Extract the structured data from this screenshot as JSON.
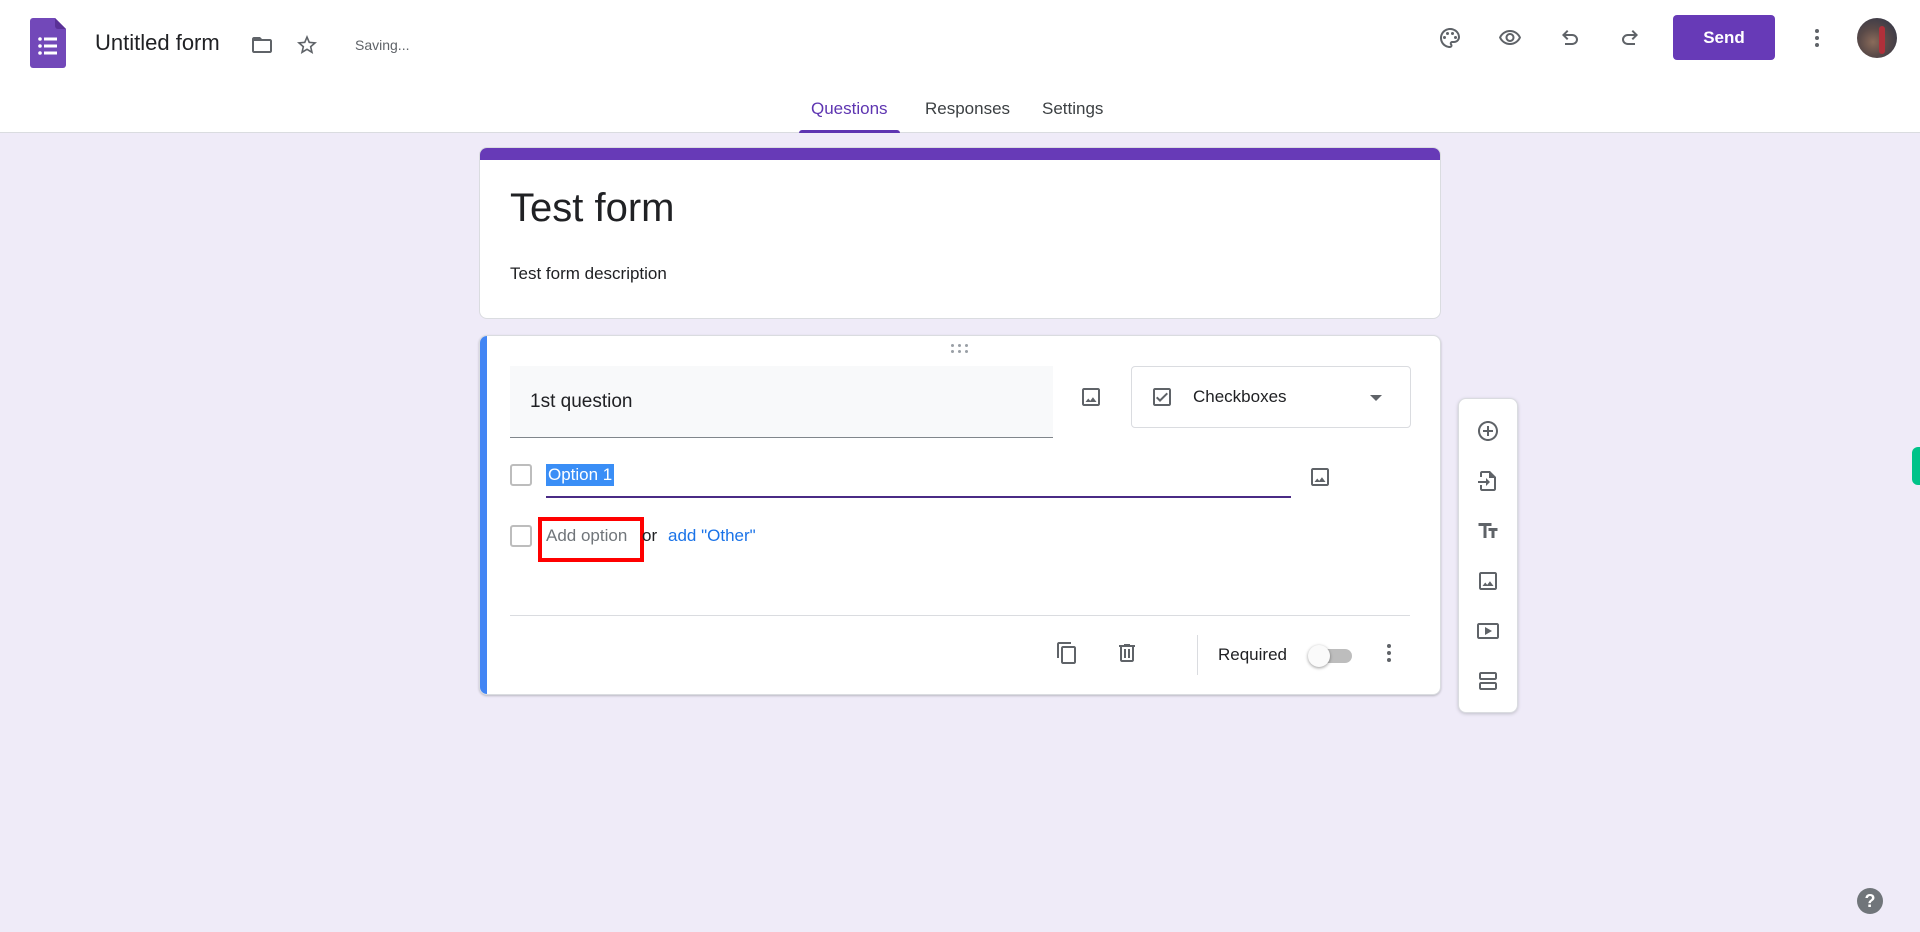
{
  "header": {
    "doc_title": "Untitled form",
    "status": "Saving...",
    "send_label": "Send",
    "icons": [
      "forms-logo-icon",
      "folder-icon",
      "star-icon",
      "palette-icon",
      "preview-eye-icon",
      "undo-icon",
      "redo-icon",
      "more-vert-icon",
      "avatar"
    ]
  },
  "tabs": [
    {
      "label": "Questions",
      "active": true
    },
    {
      "label": "Responses",
      "active": false
    },
    {
      "label": "Settings",
      "active": false
    }
  ],
  "form": {
    "title": "Test form",
    "description": "Test form description"
  },
  "question": {
    "title": "1st question",
    "type": "Checkboxes",
    "options": [
      "Option 1"
    ],
    "add_option_label": "Add option",
    "or_label": "or",
    "add_other_label": "add \"Other\"",
    "required_label": "Required",
    "required": false
  },
  "side_toolbar": {
    "items": [
      "add-question",
      "import-questions",
      "add-title-description",
      "add-image",
      "add-video",
      "add-section"
    ]
  },
  "help_label": "?",
  "colors": {
    "brand": "#673ab7",
    "active_tab": "#5e35b1",
    "question_accent": "#4285f4",
    "link": "#1a73e8",
    "background": "#efebf8",
    "highlight_box": "#ff0000"
  }
}
